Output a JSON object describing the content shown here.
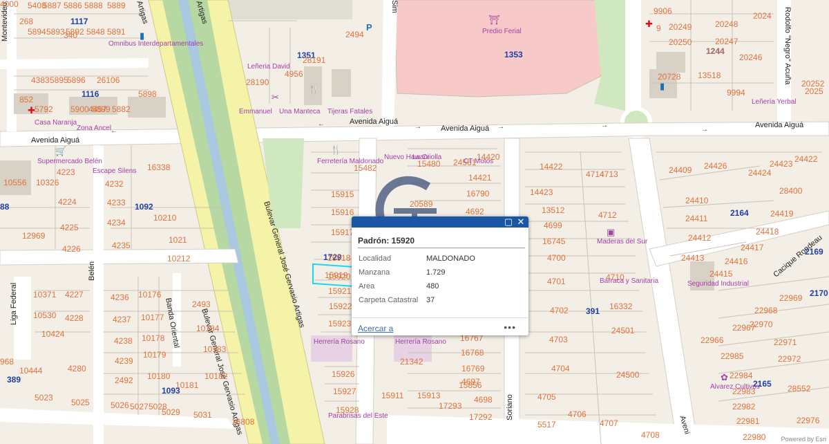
{
  "map": {
    "streets": {
      "avenida_aigua_1": "Avenida Aiguá",
      "avenida_aigua_2": "Avenida Aiguá",
      "avenida_aigua_3": "Avenida Aiguá",
      "avenida_aigua_4": "Avenida Aiguá",
      "bulevar_1": "Bulevar General José Gervasio Artigas",
      "bulevar_2": "Bulevar General José Gervasio Artigas",
      "bulevar_top": "Artigas",
      "bulevar_top2": "Artigas",
      "montevideo": "Montevideo",
      "rodolfo": "Rodolfo \"Negro\" Acuña",
      "belen": "Belén",
      "liga_federal": "Liga Federal",
      "banda_oriental": "Banda Oriental",
      "soriano": "Soriano",
      "cacique": "Cacique Rondeau",
      "simon": "Sim",
      "avenida_right": "Aveni"
    },
    "parcels": [
      "5408",
      "5887",
      "5886",
      "5888",
      "5889",
      "268",
      "5894",
      "5893",
      "5892",
      "5848",
      "5891",
      "340",
      "4383",
      "5895",
      "5896",
      "26106",
      "5898",
      "852",
      "5792",
      "5900",
      "4457",
      "5899",
      "5882",
      "10556",
      "10326",
      "4223",
      "4232",
      "4233",
      "4234",
      "4235",
      "16338",
      "10210",
      "4224",
      "4225",
      "4226",
      "12969",
      "1021",
      "10212",
      "10371",
      "4227",
      "10530",
      "4228",
      "10424",
      "4236",
      "4237",
      "4238",
      "4239",
      "2492",
      "5027",
      "5028",
      "5029",
      "5031",
      "16808",
      "10176",
      "10177",
      "10178",
      "10179",
      "10180",
      "10181",
      "10182",
      "10183",
      "10184",
      "2493",
      "4280",
      "10444",
      "5023",
      "5025",
      "5026",
      "968",
      "4000",
      "28191",
      "28190",
      "4956",
      "2494",
      "20249",
      "20250",
      "20248",
      "20247",
      "20246",
      "13518",
      "20728",
      "20252",
      "15482",
      "15915",
      "15916",
      "15917",
      "15918",
      "15919",
      "15921",
      "15922",
      "15923",
      "15920",
      "15926",
      "15927",
      "15928",
      "15480",
      "24561",
      "14420",
      "14421",
      "16790",
      "20589",
      "4692",
      "14422",
      "4714",
      "4713",
      "14423",
      "13512",
      "4699",
      "16745",
      "4700",
      "4701",
      "4702",
      "4703",
      "4704",
      "4705",
      "4706",
      "4707",
      "4708",
      "4712",
      "4710",
      "16332",
      "24501",
      "24500",
      "16767",
      "16768",
      "16769",
      "4697",
      "15856",
      "4698",
      "17293",
      "17292",
      "15911",
      "15913",
      "21342",
      "24409",
      "24426",
      "24424",
      "24423",
      "24422",
      "24410",
      "28400",
      "24411",
      "24419",
      "24418",
      "24412",
      "24417",
      "24413",
      "24416",
      "24415",
      "22969",
      "22968",
      "22967",
      "22970",
      "22966",
      "22971",
      "22985",
      "22972",
      "22984",
      "22983",
      "28552",
      "22982",
      "22981",
      "22980",
      "22976",
      "1244",
      "9994",
      "9",
      "5517",
      "2025",
      "2024",
      "9906"
    ],
    "blocks": [
      "1117",
      "1116",
      "1092",
      "1093",
      "389",
      "88",
      "1351",
      "1353",
      "1244",
      "2164",
      "2169",
      "2170",
      "2165",
      "391",
      "1729"
    ],
    "pois": {
      "omnibus": "Omnibus Interdepartamentales",
      "lenieria": "Leñeria David",
      "emmanuel": "Emmanuel",
      "una_manteca": "Una Manteca",
      "tijeras": "Tijeras Fatales",
      "casa_naranja": "Casa Naranja",
      "zona_ancel": "Zona Ancel",
      "supermercado": "Supermercado Belén",
      "escape": "Escape Silens",
      "predio": "Predio Ferial",
      "ferreteria": "Ferretería Maldonado",
      "nuevo_hawani": "Nuevo Hawani",
      "la_criolla": "La Criolla",
      "ct_motos": "CT Motos",
      "herreria1": "Herrería Rosano",
      "herreria2": "Herrería Rosano",
      "parabrisas": "Parabrisas del Este",
      "lenieria_yerbal": "Leñería Yerbal",
      "maderas": "Maderas del Sur",
      "barraca": "Barraca y Sanitaria",
      "seguridad": "Seguridad Industrial",
      "alvarez": "Alvarez Cultivos"
    }
  },
  "popup": {
    "title": "Padrón: 15920",
    "rows": [
      {
        "label": "Localidad",
        "value": "MALDONADO"
      },
      {
        "label": "Manzana",
        "value": "1.729"
      },
      {
        "label": "Area",
        "value": "480"
      },
      {
        "label": "Carpeta Catastral",
        "value": "37"
      }
    ],
    "zoom_link": "Acercar a",
    "more": "•••"
  },
  "attribution": "Powered by Esri",
  "colors": {
    "road": "#ffffff",
    "boulevard": "#f5f3a8",
    "median": "#b7d8a2",
    "fairground": "#f8c9c9",
    "green": "#cfe8bf",
    "popup_bar": "#1b57a6",
    "highlight": "#19d6ee"
  }
}
